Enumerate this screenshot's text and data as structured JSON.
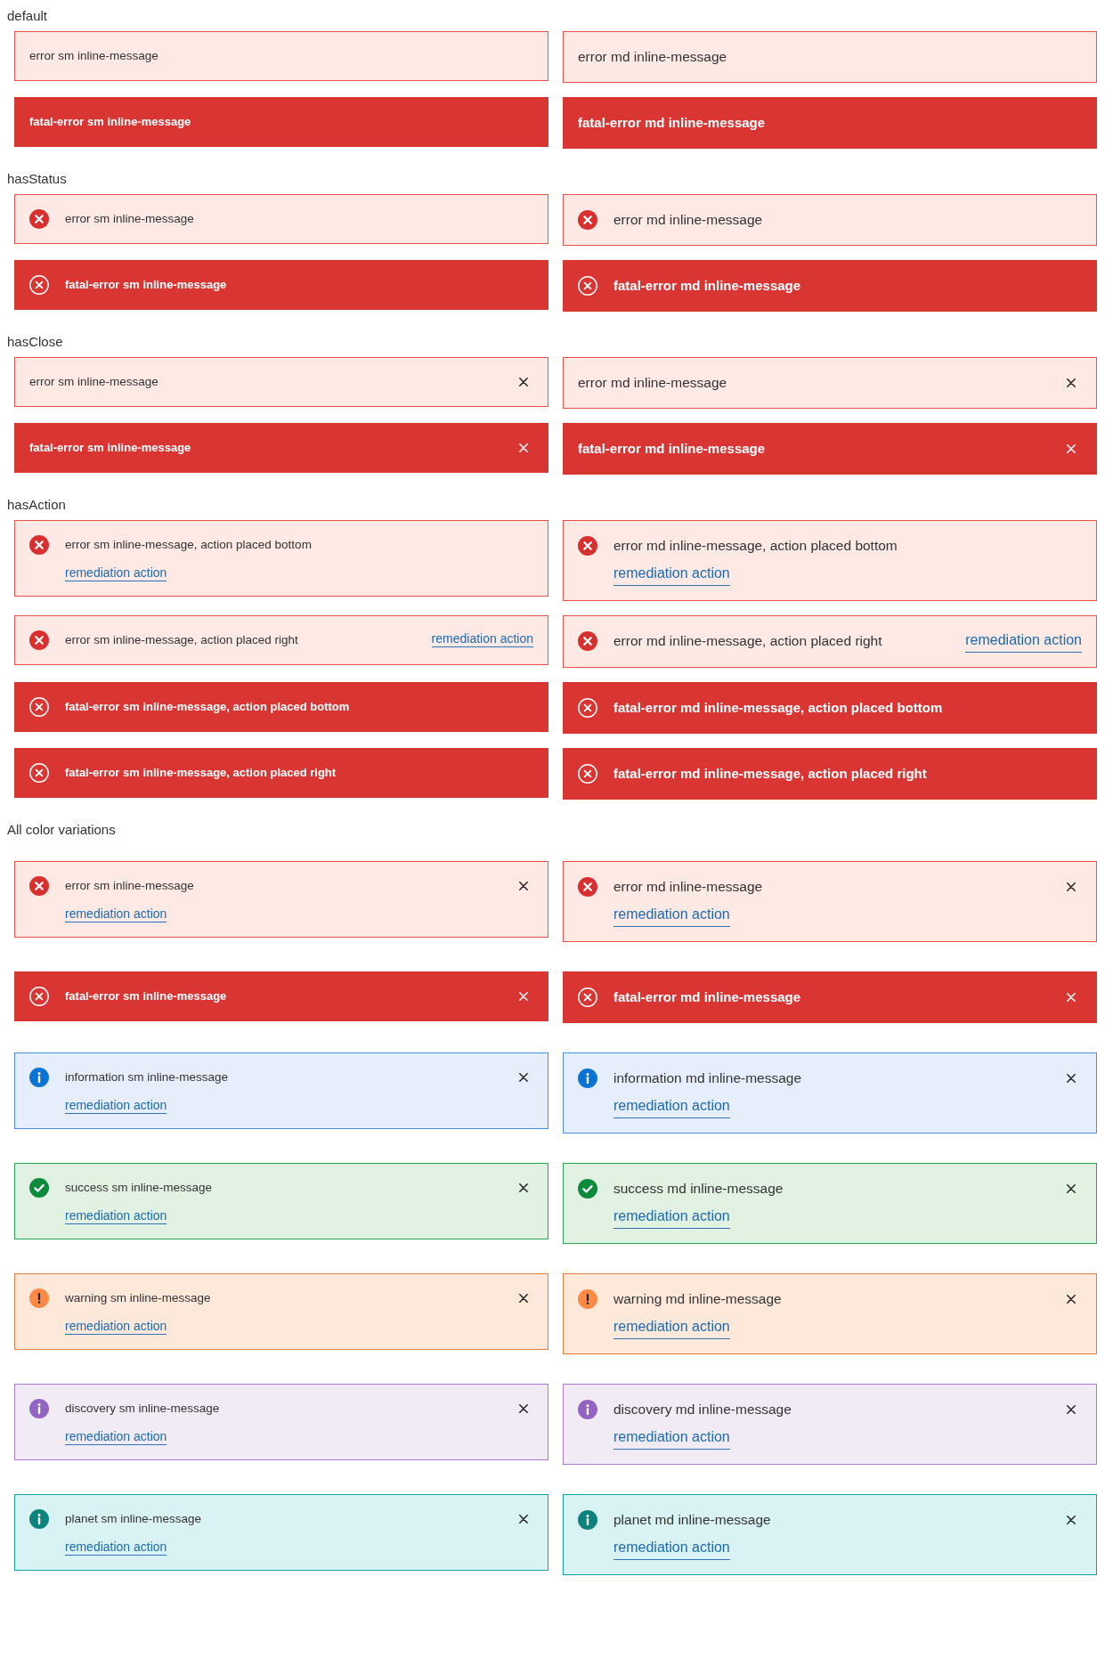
{
  "sections": [
    {
      "title": "default",
      "rows": [
        [
          {
            "kind": "error",
            "compact": true,
            "text": "error sm inline-message",
            "has_status": false,
            "has_close": false
          },
          {
            "kind": "error",
            "compact": false,
            "text": "error md inline-message",
            "has_status": false,
            "has_close": false
          }
        ],
        [
          {
            "kind": "fatal-error",
            "compact": true,
            "text": "fatal-error sm inline-message",
            "has_status": false,
            "has_close": false
          },
          {
            "kind": "fatal-error",
            "compact": false,
            "text": "fatal-error md inline-message",
            "has_status": false,
            "has_close": false
          }
        ]
      ]
    },
    {
      "title": "hasStatus",
      "rows": [
        [
          {
            "kind": "error",
            "compact": true,
            "text": "error sm inline-message",
            "has_status": true,
            "has_close": false
          },
          {
            "kind": "error",
            "compact": false,
            "text": "error md inline-message",
            "has_status": true,
            "has_close": false
          }
        ],
        [
          {
            "kind": "fatal-error",
            "compact": true,
            "text": "fatal-error sm inline-message",
            "has_status": true,
            "has_close": false
          },
          {
            "kind": "fatal-error",
            "compact": false,
            "text": "fatal-error md inline-message",
            "has_status": true,
            "has_close": false
          }
        ]
      ]
    },
    {
      "title": "hasClose",
      "rows": [
        [
          {
            "kind": "error",
            "compact": true,
            "text": "error sm inline-message",
            "has_status": false,
            "has_close": true
          },
          {
            "kind": "error",
            "compact": false,
            "text": "error md inline-message",
            "has_status": false,
            "has_close": true
          }
        ],
        [
          {
            "kind": "fatal-error",
            "compact": true,
            "text": "fatal-error sm inline-message",
            "has_status": false,
            "has_close": true
          },
          {
            "kind": "fatal-error",
            "compact": false,
            "text": "fatal-error md inline-message",
            "has_status": false,
            "has_close": true
          }
        ]
      ]
    },
    {
      "title": "hasAction",
      "rows": [
        [
          {
            "kind": "error",
            "compact": true,
            "text": "error sm inline-message, action placed bottom",
            "has_status": true,
            "has_close": false,
            "action": {
              "label": "remediation action",
              "placed_right": false
            }
          },
          {
            "kind": "error",
            "compact": false,
            "text": "error md inline-message, action placed bottom",
            "has_status": true,
            "has_close": false,
            "action": {
              "label": "remediation action",
              "placed_right": false
            }
          }
        ],
        [
          {
            "kind": "error",
            "compact": true,
            "text": "error sm inline-message, action placed right",
            "has_status": true,
            "has_close": false,
            "action": {
              "label": "remediation action",
              "placed_right": true
            }
          },
          {
            "kind": "error",
            "compact": false,
            "text": "error md inline-message, action placed right",
            "has_status": true,
            "has_close": false,
            "action": {
              "label": "remediation action",
              "placed_right": true
            }
          }
        ],
        [
          {
            "kind": "fatal-error",
            "compact": true,
            "text": "fatal-error sm inline-message, action placed bottom",
            "has_status": true,
            "has_close": false
          },
          {
            "kind": "fatal-error",
            "compact": false,
            "text": "fatal-error md inline-message, action placed bottom",
            "has_status": true,
            "has_close": false
          }
        ],
        [
          {
            "kind": "fatal-error",
            "compact": true,
            "text": "fatal-error sm inline-message, action placed right",
            "has_status": true,
            "has_close": false
          },
          {
            "kind": "fatal-error",
            "compact": false,
            "text": "fatal-error md inline-message, action placed right",
            "has_status": true,
            "has_close": false
          }
        ]
      ]
    },
    {
      "title": "All color variations",
      "rows": [
        [
          {
            "kind": "error",
            "compact": true,
            "text": "error sm inline-message",
            "has_status": true,
            "has_close": true,
            "action": {
              "label": "remediation action",
              "placed_right": false
            }
          },
          {
            "kind": "error",
            "compact": false,
            "text": "error md inline-message",
            "has_status": true,
            "has_close": true,
            "action": {
              "label": "remediation action",
              "placed_right": false
            }
          }
        ],
        [
          {
            "kind": "fatal-error",
            "compact": true,
            "text": "fatal-error sm inline-message",
            "has_status": true,
            "has_close": true
          },
          {
            "kind": "fatal-error",
            "compact": false,
            "text": "fatal-error md inline-message",
            "has_status": true,
            "has_close": true
          }
        ],
        [
          {
            "kind": "information",
            "compact": true,
            "text": "information sm inline-message",
            "has_status": true,
            "has_close": true,
            "action": {
              "label": "remediation action",
              "placed_right": false
            }
          },
          {
            "kind": "information",
            "compact": false,
            "text": "information md inline-message",
            "has_status": true,
            "has_close": true,
            "action": {
              "label": "remediation action",
              "placed_right": false
            }
          }
        ],
        [
          {
            "kind": "success",
            "compact": true,
            "text": "success sm inline-message",
            "has_status": true,
            "has_close": true,
            "action": {
              "label": "remediation action",
              "placed_right": false
            }
          },
          {
            "kind": "success",
            "compact": false,
            "text": "success md inline-message",
            "has_status": true,
            "has_close": true,
            "action": {
              "label": "remediation action",
              "placed_right": false
            }
          }
        ],
        [
          {
            "kind": "warning",
            "compact": true,
            "text": "warning sm inline-message",
            "has_status": true,
            "has_close": true,
            "action": {
              "label": "remediation action",
              "placed_right": false
            }
          },
          {
            "kind": "warning",
            "compact": false,
            "text": "warning md inline-message",
            "has_status": true,
            "has_close": true,
            "action": {
              "label": "remediation action",
              "placed_right": false
            }
          }
        ],
        [
          {
            "kind": "discovery",
            "compact": true,
            "text": "discovery sm inline-message",
            "has_status": true,
            "has_close": true,
            "action": {
              "label": "remediation action",
              "placed_right": false
            }
          },
          {
            "kind": "discovery",
            "compact": false,
            "text": "discovery md inline-message",
            "has_status": true,
            "has_close": true,
            "action": {
              "label": "remediation action",
              "placed_right": false
            }
          }
        ],
        [
          {
            "kind": "planet",
            "compact": true,
            "text": "planet sm inline-message",
            "has_status": true,
            "has_close": true,
            "action": {
              "label": "remediation action",
              "placed_right": false
            }
          },
          {
            "kind": "planet",
            "compact": false,
            "text": "planet md inline-message",
            "has_status": true,
            "has_close": true,
            "action": {
              "label": "remediation action",
              "placed_right": false
            }
          }
        ]
      ]
    }
  ]
}
